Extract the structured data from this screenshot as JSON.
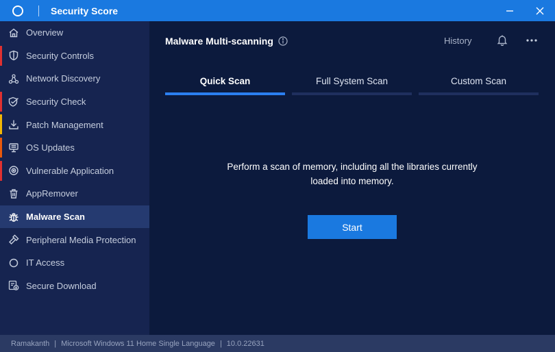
{
  "window": {
    "title": "Security Score",
    "logo_icon": "circle-logo-icon",
    "controls": [
      "minimize-icon",
      "close-icon"
    ]
  },
  "sidebar": {
    "items": [
      {
        "label": "Overview",
        "icon": "home-icon",
        "marker_color": null
      },
      {
        "label": "Security Controls",
        "icon": "shield-icon",
        "marker_color": "#e03131"
      },
      {
        "label": "Network Discovery",
        "icon": "network-icon",
        "marker_color": null
      },
      {
        "label": "Security Check",
        "icon": "shield-check-icon",
        "marker_color": "#e03131"
      },
      {
        "label": "Patch Management",
        "icon": "download-icon",
        "marker_color": "#f2b705"
      },
      {
        "label": "OS Updates",
        "icon": "server-icon",
        "marker_color": "#e8590c"
      },
      {
        "label": "Vulnerable Application",
        "icon": "target-icon",
        "marker_color": "#e03131"
      },
      {
        "label": "AppRemover",
        "icon": "trash-icon",
        "marker_color": null
      },
      {
        "label": "Malware Scan",
        "icon": "bug-icon",
        "marker_color": null,
        "active": true
      },
      {
        "label": "Peripheral Media Protection",
        "icon": "usb-icon",
        "marker_color": null
      },
      {
        "label": "IT Access",
        "icon": "circle-icon",
        "marker_color": null
      },
      {
        "label": "Secure Download",
        "icon": "secure-download-icon",
        "marker_color": null
      }
    ]
  },
  "header": {
    "title": "Malware Multi-scanning",
    "info_icon": "info-icon",
    "history_label": "History",
    "bell_icon": "bell-icon",
    "more_icon": "more-horizontal-icon"
  },
  "tabs": [
    {
      "label": "Quick Scan",
      "active": true
    },
    {
      "label": "Full System Scan",
      "active": false
    },
    {
      "label": "Custom Scan",
      "active": false
    }
  ],
  "content": {
    "description_line1": "Perform a scan of memory, including all the libraries currently",
    "description_line2": "loaded into memory.",
    "start_label": "Start"
  },
  "statusbar": {
    "user": "Ramakanth",
    "os": "Microsoft Windows 11 Home Single Language",
    "version": "10.0.22631",
    "separator": "|"
  },
  "colors": {
    "accent": "#1a79e0",
    "sidebar_bg": "#162450",
    "main_bg": "#0c1a3d",
    "active_item_bg": "#253a70",
    "status_red": "#e03131",
    "status_yellow": "#f2b705",
    "status_orange": "#e8590c"
  }
}
